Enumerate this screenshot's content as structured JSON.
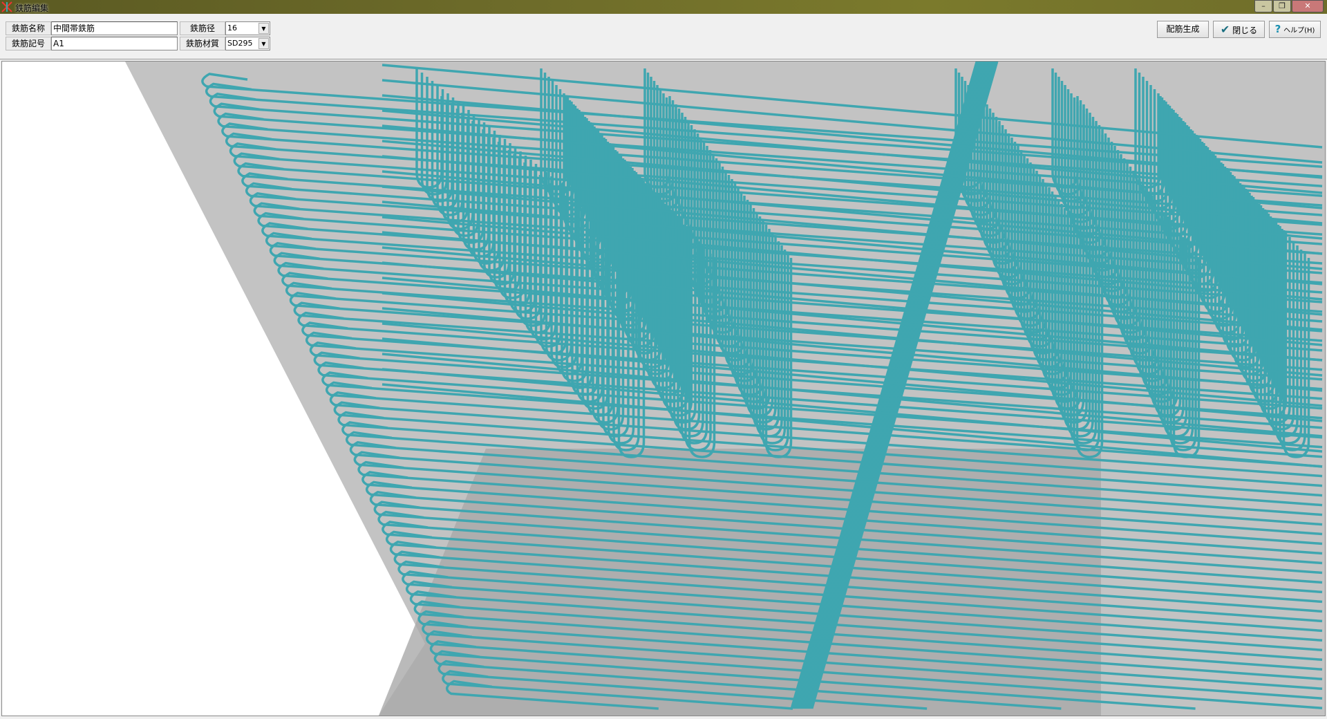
{
  "window": {
    "title": "鉄筋編集",
    "minimize": "–",
    "restore": "❐",
    "close": "✕"
  },
  "form": {
    "name_label": "鉄筋名称",
    "name_value": "中間帯鉄筋",
    "symbol_label": "鉄筋記号",
    "symbol_value": "A1",
    "diameter_label": "鉄筋径",
    "diameter_value": "16",
    "material_label": "鉄筋材質",
    "material_value": "SD295"
  },
  "buttons": {
    "generate": "配筋生成",
    "close": "閉じる",
    "help": "ヘルプ(H)"
  },
  "colors": {
    "rebar": "#3fa6b0",
    "background": "#c3c3c3",
    "shadow": "#a9a9a9"
  }
}
